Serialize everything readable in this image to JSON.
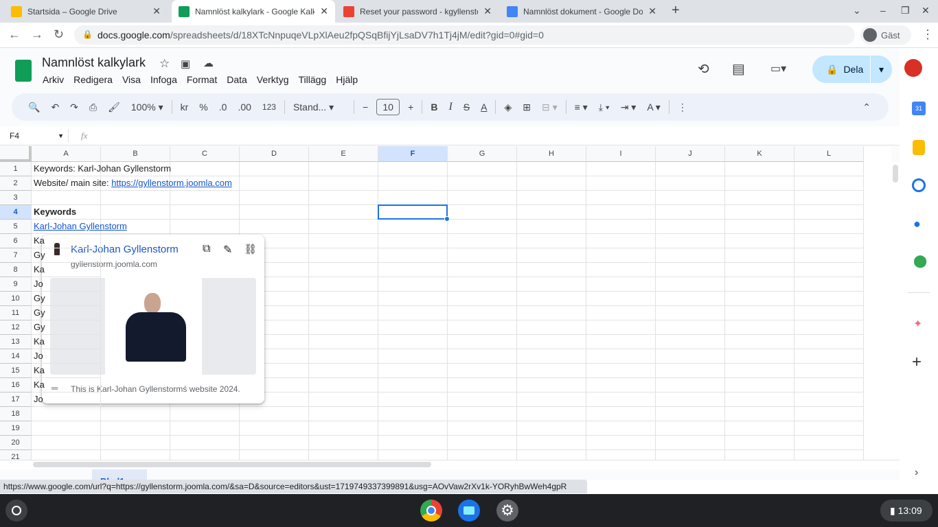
{
  "browser": {
    "tabs": [
      {
        "title": "Startsida – Google Drive",
        "icon": "google-drive-icon",
        "color": "#fbbc04",
        "active": false
      },
      {
        "title": "Namnlöst kalkylark - Google Kalkylark",
        "icon": "google-sheets-icon",
        "color": "#0f9d58",
        "active": true
      },
      {
        "title": "Reset your password - kgyllenstorm",
        "icon": "gmail-icon",
        "color": "#ea4335",
        "active": false
      },
      {
        "title": "Namnlöst dokument - Google Docs",
        "icon": "google-docs-icon",
        "color": "#4285f4",
        "active": false
      }
    ],
    "url_host": "docs.google.com",
    "url_path": "/spreadsheets/d/18XTcNnpuqeVLpXlAeu2fpQSqBfijYjLsaDV7h1Tj4jM/edit?gid=0#gid=0",
    "profile": "Gäst"
  },
  "doc": {
    "title": "Namnlöst kalkylark",
    "share_label": "Dela",
    "menu": [
      "Arkiv",
      "Redigera",
      "Visa",
      "Infoga",
      "Format",
      "Data",
      "Verktyg",
      "Tillägg",
      "Hjälp"
    ]
  },
  "toolbar": {
    "zoom": "100%",
    "currency": "kr",
    "percent": "%",
    "dec_less": ".0",
    "dec_more": ".00",
    "number_format": "123",
    "font": "Stand...",
    "font_size": "10"
  },
  "formula_bar": {
    "name_box": "F4",
    "fx": "fx",
    "value": ""
  },
  "grid": {
    "columns": [
      "A",
      "B",
      "C",
      "D",
      "E",
      "F",
      "G",
      "H",
      "I",
      "J",
      "K",
      "L"
    ],
    "row_count": 21,
    "selected_cell": "F4",
    "cells": [
      {
        "ref": "A1",
        "text": "Keywords: Karl-Johan Gyllenstorm"
      },
      {
        "ref": "A2",
        "text": "Website/ main site: ",
        "link": "https://gyllenstorm.joomla.com"
      },
      {
        "ref": "A4",
        "text": "Keywords",
        "bold": true
      },
      {
        "ref": "A5",
        "link": "Karl-Johan Gyllenstorm"
      },
      {
        "ref": "A6",
        "text": "Ka"
      },
      {
        "ref": "A7",
        "text": "Gy"
      },
      {
        "ref": "A8",
        "text": "Ka"
      },
      {
        "ref": "A9",
        "text": "Jo"
      },
      {
        "ref": "A10",
        "text": "Gy"
      },
      {
        "ref": "A11",
        "text": "Gy"
      },
      {
        "ref": "A12",
        "text": "Gy"
      },
      {
        "ref": "A13",
        "text": "Ka"
      },
      {
        "ref": "A14",
        "text": "Jo"
      },
      {
        "ref": "A15",
        "text": "Ka"
      },
      {
        "ref": "A16",
        "text": "Ka"
      },
      {
        "ref": "A17",
        "text": "Jo"
      }
    ]
  },
  "link_preview": {
    "title": "Karl-Johan Gyllenstorm",
    "domain": "gyllenstorm.joomla.com",
    "description": "This is Karl-Johan Gyllenstormś website 2024."
  },
  "sheet_tab": "Blad1",
  "status_url": "https://www.google.com/url?q=https://gyllenstorm.joomla.com/&sa=D&source=editors&ust=1719749337399891&usg=AOvVaw2rXv1k-YORyhBwWeh4gpR",
  "shelf": {
    "time": "13:09",
    "apps": [
      "chrome-icon",
      "files-icon",
      "settings-icon"
    ]
  }
}
